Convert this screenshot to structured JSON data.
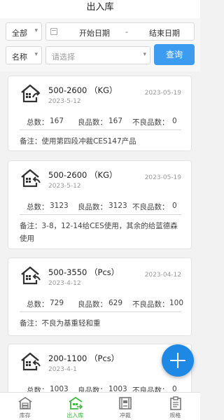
{
  "header": {
    "title": "出入库"
  },
  "filters": {
    "scope": {
      "selected": "全部"
    },
    "date_range": {
      "start_placeholder": "开始日期",
      "separator": "-",
      "end_placeholder": "结束日期"
    },
    "field": {
      "selected": "名称"
    },
    "keyword": {
      "placeholder": "请选择"
    },
    "search_label": "查询"
  },
  "records": [
    {
      "icon": "warehouse-inbound-icon",
      "spec": "500-2600 （KG）",
      "sub_date": "2023-5-12",
      "date": "2023-05-19",
      "total_label": "总数：",
      "total": "167",
      "good_label": "良品数：",
      "good": "167",
      "bad_label": "不良品数：",
      "bad": "0",
      "note": "备注：使用第四段冲裁CES147产品"
    },
    {
      "icon": "warehouse-outbound-icon",
      "spec": "500-2600 （KG）",
      "sub_date": "2023-5-12",
      "date": "2023-05-19",
      "total_label": "总数：",
      "total": "3123",
      "good_label": "良品数：",
      "good": "3123",
      "bad_label": "不良品数：",
      "bad": "0",
      "note": "备注：3-8，12-14给CES使用，其余的给蓝德森使用"
    },
    {
      "icon": "warehouse-outbound-icon",
      "spec": "500-3550 （Pcs）",
      "sub_date": "2023-4-12",
      "date": "2023-04-12",
      "total_label": "总数：",
      "total": "729",
      "good_label": "良品数：",
      "good": "629",
      "bad_label": "不良品数：",
      "bad": "100",
      "note": "备注：不良为基重轻和重"
    },
    {
      "icon": "warehouse-outbound-icon",
      "spec": "200-1100 （Pcs）",
      "sub_date": "2023-4-1",
      "date": "2023",
      "total_label": "总数：",
      "total": "1003",
      "good_label": "良品数：",
      "good": "1003",
      "bad_label": "不良品数：",
      "bad": "0",
      "note": ""
    }
  ],
  "fab": {
    "icon": "plus-icon"
  },
  "tabbar": [
    {
      "label": "库存",
      "icon": "inventory-icon",
      "active": false
    },
    {
      "label": "出入库",
      "icon": "inout-icon",
      "active": true
    },
    {
      "label": "冲裁",
      "icon": "press-icon",
      "active": false
    },
    {
      "label": "规格",
      "icon": "spec-sheet-icon",
      "active": false
    }
  ],
  "colors": {
    "accent": "#3d9bf0",
    "fab": "#1e88e5",
    "tab_active": "#3eb83e",
    "background": "#f2f2f2"
  }
}
